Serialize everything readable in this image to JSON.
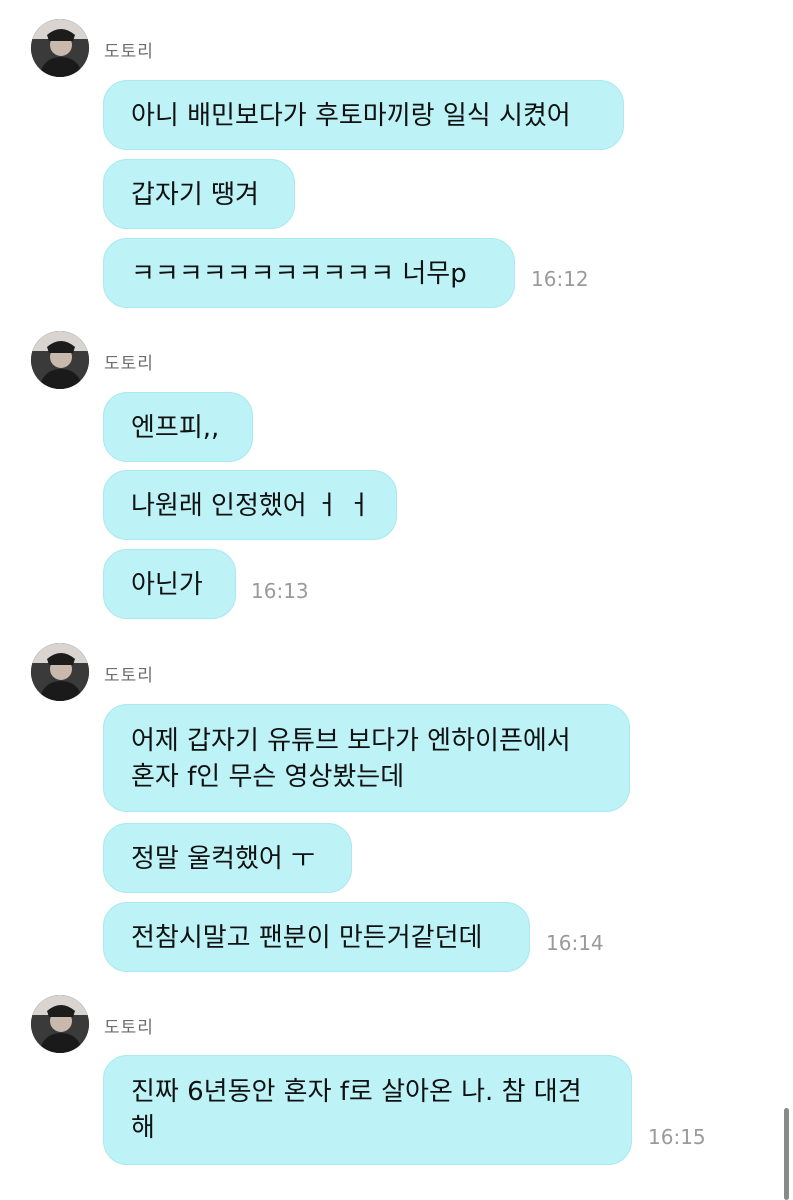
{
  "sender_name": "도토리",
  "groups": [
    {
      "messages": [
        {
          "text": "아니 배민보다가 후토마끼랑 일식 시켰어"
        },
        {
          "text": "갑자기 땡겨"
        },
        {
          "text": "ㅋㅋㅋㅋㅋㅋㅋㅋㅋㅋㅋ 너무p",
          "time": "16:12"
        }
      ]
    },
    {
      "messages": [
        {
          "text": "엔프피,,"
        },
        {
          "text": "나원래 인정했어 ㅓ ㅓ"
        },
        {
          "text": "아닌가",
          "time": "16:13"
        }
      ]
    },
    {
      "messages": [
        {
          "line1": "어제 갑자기 유튜브 보다가 엔하이픈에서",
          "line2": "혼자 f인 무슨 영상봤는데"
        },
        {
          "text": "정말 울컥했어 ㅜ"
        },
        {
          "text": "전참시말고 팬분이 만든거같던데",
          "time": "16:14"
        }
      ]
    },
    {
      "messages": [
        {
          "line1": "진짜 6년동안 혼자 f로 살아온 나. 참 대견",
          "line2": "해",
          "time": "16:15"
        }
      ]
    }
  ],
  "colors": {
    "bubble": "#bdf2f6",
    "time": "#9a9a9a",
    "sender": "#6d6d6d"
  },
  "icons": {
    "avatar": "profile-photo-avatar"
  }
}
